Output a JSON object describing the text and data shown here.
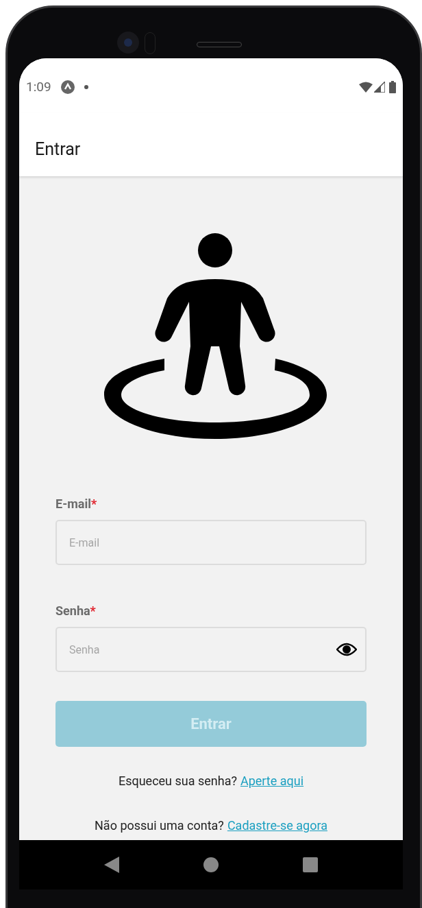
{
  "status_bar": {
    "time": "1:09"
  },
  "app_bar": {
    "title": "Entrar"
  },
  "fields": [
    {
      "kind": "text",
      "label": "E-mail",
      "required_mark": "*",
      "placeholder": "E-mail"
    },
    {
      "kind": "password",
      "label": "Senha",
      "required_mark": "*",
      "placeholder": "Senha"
    }
  ],
  "submit_button": {
    "label": "Entrar",
    "disabled": true
  },
  "links": [
    {
      "prompt": "Esqueceu sua senha?",
      "link": "Aperte aqui"
    },
    {
      "prompt": "Não possui uma conta?",
      "link": "Cadastre-se agora"
    }
  ]
}
